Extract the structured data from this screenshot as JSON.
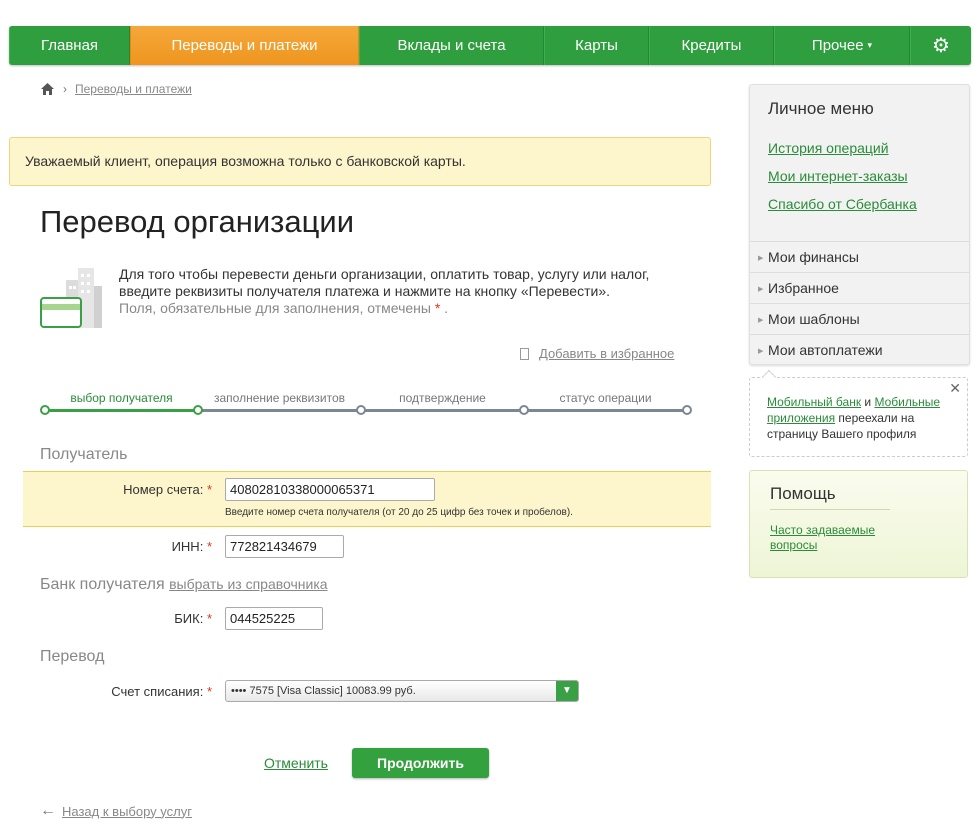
{
  "nav": {
    "items": [
      "Главная",
      "Переводы и платежи",
      "Вклады и счета",
      "Карты",
      "Кредиты",
      "Прочее"
    ],
    "more_caret": "▾"
  },
  "breadcrumb": {
    "current": "Переводы и платежи"
  },
  "warning": "Уважаемый клиент, операция возможна только с банковской карты.",
  "title": "Перевод организации",
  "intro": {
    "text": "Для того чтобы перевести деньги организации, оплатить товар, услугу или налог, введите реквизиты получателя платежа и нажмите на кнопку «Перевести».",
    "required_note": "Поля, обязательные для заполнения, отмечены",
    "star": "*",
    "dot": "."
  },
  "favorite": "Добавить в избранное",
  "steps": [
    {
      "label": "выбор получателя",
      "active": true
    },
    {
      "label": "заполнение реквизитов",
      "active": false
    },
    {
      "label": "подтверждение",
      "active": false
    },
    {
      "label": "статус операции",
      "active": false
    }
  ],
  "sections": {
    "recipient": "Получатель",
    "bank": "Банк получателя",
    "bank_link": "выбрать из справочника",
    "transfer": "Перевод"
  },
  "fields": {
    "account": {
      "label": "Номер счета:",
      "value": "40802810338000065371",
      "hint": "Введите номер счета получателя (от 20 до 25 цифр без точек и пробелов)."
    },
    "inn": {
      "label": "ИНН:",
      "value": "772821434679"
    },
    "bik": {
      "label": "БИК:",
      "value": "044525225"
    },
    "source": {
      "label": "Счет списания:",
      "value": "•••• 7575 [Visa Classic] 10083.99 руб."
    }
  },
  "actions": {
    "cancel": "Отменить",
    "continue": "Продолжить",
    "back": "Назад к выбору услуг"
  },
  "sidebar": {
    "title": "Личное меню",
    "links": [
      "История операций",
      "Мои интернет-заказы",
      "Спасибо от Сбербанка"
    ],
    "menu": [
      "Мои финансы",
      "Избранное",
      "Мои шаблоны",
      "Мои автоплатежи"
    ]
  },
  "notice": {
    "link1": "Мобильный банк",
    "and": " и ",
    "link2": "Мобильные приложения",
    "rest": " переехали на страницу Вашего профиля"
  },
  "help": {
    "title": "Помощь",
    "faq": "Часто задаваемые вопросы"
  },
  "colors": {
    "brand_green": "#2e9e3e",
    "active_orange": "#f5a83a",
    "warning_bg": "#fdf6cc"
  }
}
